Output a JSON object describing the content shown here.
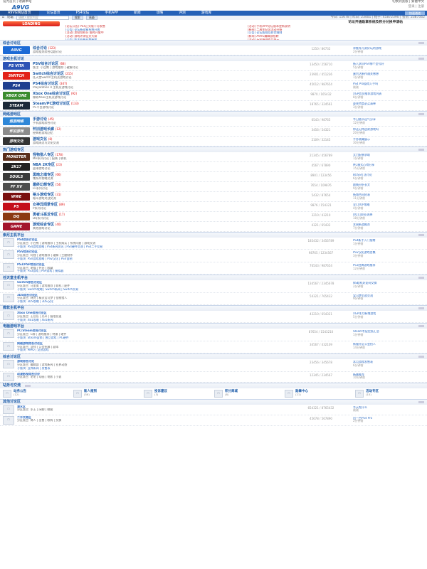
{
  "topbar": {
    "left": "设为首页 | 收藏本站",
    "right": "切换到宽版 | 繁體中文"
  },
  "logo_text": "A9VG",
  "user_text": "登录 | 注册",
  "nav": {
    "items": [
      "A9VG网站首页",
      "论坛首页",
      "PS4论坛",
      "手机APP",
      "新闻",
      "攻略",
      "评测",
      "游戏库"
    ],
    "home_btn": "快速通道"
  },
  "subbar": {
    "breadcrumb": "论坛",
    "search_placeholder": "请输入搜索内容",
    "search_btn": "搜索",
    "adv_btn": "高级",
    "stats": "今日: 15678 | 昨日: 23401 | 帖子: 45872390 | 会员: 2387562"
  },
  "notice": {
    "loading": "LOADING",
    "title": "论坛开通勋章系统及积分兑换申请帖",
    "items": [
      "[论坛公告] PS4正式版十月发售",
      "[活动] 手机APP论坛版本更新说明",
      "[公告] 论坛新勋章系统开放",
      "[新闻] 二周年纪念活动开始",
      "[活动] 发帖领积分 限时开放中",
      "[公告] 论坛版规及处罚细则",
      "[活动] 游戏评测征文大赛",
      "[新闻] A9VG编辑部招聘",
      "[公告] 版主招募长期有效",
      "[活动] 玩家原创作品展示",
      "[新闻] 东京电玩展专题上线",
      "[公告] 举报违规帖子须知"
    ]
  },
  "sections": [
    {
      "title": "综合讨论区",
      "forums": [
        {
          "badge": "A9VG",
          "color": "#1d6bd6",
          "name": "综合讨论",
          "new": "(123)",
          "desc": "游戏相关综合话题讨论",
          "stat": "1250 / 86732",
          "last": "求推荐几款好玩的游戏",
          "date": "2分钟前"
        }
      ]
    },
    {
      "title": "游戏主机讨论",
      "forums": [
        {
          "badge": "PS VITA",
          "color": "#2d53b5",
          "name": "PSV综合讨论区",
          "new": "(68)",
          "desc": "版主: 小白熊 | 游戏推荐 | 破解讨论",
          "stat": "13450 / 256710",
          "last": "新人求问PSV哪个型号好",
          "date": "5分钟前"
        },
        {
          "badge": "SWITCH",
          "color": "#e2231a",
          "name": "Switch综合讨论区",
          "new": "(215)",
          "desc": "任天堂Switch主机及游戏讨论",
          "stat": "23901 / 451236",
          "last": "塞尔达新作通关感想",
          "date": "1分钟前"
        },
        {
          "badge": "PS4",
          "color": "#1f3f8f",
          "name": "PS4综合讨论区",
          "new": "(347)",
          "desc": "PlayStation 4 主机及游戏讨论",
          "stat": "45012 / 987654",
          "last": "PS4 Pro值得入手吗",
          "date": "刚刚"
        },
        {
          "badge": "XBOX ONE",
          "color": "#3b8c2e",
          "name": "Xbox One综合讨论区",
          "new": "(92)",
          "desc": "微软Xbox主机及游戏讨论",
          "stat": "9870 / 165432",
          "last": "XGP会员推荐游戏列表",
          "date": "8分钟前"
        },
        {
          "badge": "STEAM",
          "color": "#1b2838",
          "name": "Steam/PC游戏讨论区",
          "new": "(133)",
          "desc": "PC平台游戏讨论",
          "stat": "18765 / 324561",
          "last": "夏季特卖必买清单",
          "date": "3分钟前"
        }
      ]
    },
    {
      "title": "网络游戏区",
      "forums": [
        {
          "badge": "悠游网络",
          "color": "#2f87d8",
          "name": "手游讨论",
          "new": "(45)",
          "desc": "手机游戏综合讨论",
          "stat": "6543 / 98765",
          "last": "今日抽卡运气分享",
          "date": "12分钟前"
        },
        {
          "badge": "怀旧游戏",
          "color": "#8c8c8c",
          "name": "怀旧游戏长廊",
          "new": "(12)",
          "desc": "经典老游戏回忆",
          "stat": "3456 / 54321",
          "last": "你还记得这款游戏吗",
          "date": "20分钟前"
        },
        {
          "badge": "游戏文化",
          "color": "#333333",
          "name": "游戏文化",
          "new": "(8)",
          "desc": "游戏周边与文化交流",
          "stat": "2109 / 32145",
          "last": "手办收藏展示",
          "date": "30分钟前"
        }
      ]
    },
    {
      "title": "热门游戏专区",
      "forums": [
        {
          "badge": "MONSTER",
          "color": "#5a2e1a",
          "name": "怪物猎人专区",
          "new": "(178)",
          "desc": "MH系列讨论 | 配装 | 联机",
          "stat": "21345 / 456789",
          "last": "太刀配装求助",
          "date": "1分钟前"
        },
        {
          "badge": "2K17",
          "color": "#222222",
          "name": "NBA 2K专区",
          "new": "(23)",
          "desc": "篮球游戏讨论",
          "stat": "4567 / 67890",
          "last": "MC模式心得分享",
          "date": "15分钟前"
        },
        {
          "badge": "SOULS",
          "color": "#3a3a3a",
          "name": "黑暗之魂专区",
          "new": "(66)",
          "desc": "魂系列攻略交流",
          "stat": "8901 / 123456",
          "last": "BOSS打法讨论",
          "date": "6分钟前"
        },
        {
          "badge": "FF XV",
          "color": "#4d4d4d",
          "name": "最终幻想专区",
          "new": "(54)",
          "desc": "FF系列讨论",
          "stat": "7654 / 109876",
          "last": "剧情分析长文",
          "date": "9分钟前"
        },
        {
          "badge": "WWE",
          "color": "#7a1010",
          "name": "格斗游戏专区",
          "new": "(31)",
          "desc": "格斗游戏对战交流",
          "stat": "5432 / 87654",
          "last": "新角色出招表",
          "date": "11分钟前"
        },
        {
          "badge": "P5",
          "color": "#c40f1a",
          "name": "女神异闻录专区",
          "new": "(89)",
          "desc": "P系列讨论",
          "stat": "9876 / 154321",
          "last": "全COOP攻略",
          "date": "4分钟前"
        },
        {
          "badge": "DQ",
          "color": "#8b3a12",
          "name": "勇者斗恶龙专区",
          "new": "(17)",
          "desc": "DQ系列讨论",
          "stat": "3210 / 43210",
          "last": "DQ11职业选择",
          "date": "18分钟前"
        },
        {
          "badge": "GAME",
          "color": "#a3142c",
          "name": "游戏综合专区",
          "new": "(40)",
          "desc": "其他游戏讨论",
          "stat": "4321 / 65432",
          "last": "本周新游推荐",
          "date": "7分钟前"
        }
      ]
    }
  ],
  "lower_sections": [
    {
      "title": "索尼主机平台",
      "rows": [
        {
          "name": "PS4综合讨论区",
          "lines": [
            "分区版主: 小白熊 | 游戏推荐 | 主机购买 | 系统问题 | 游戏交流",
            "子版块: PS4游戏攻略 | PS4新闻资讯 | PS4硬件交流 | PS4二手交易"
          ],
          "stat": "185432 / 3456789",
          "last": "PS4新手入门指南",
          "date": "1分钟前"
        },
        {
          "name": "PSV综合讨论区",
          "lines": [
            "分区版主: 阿狸 | 游戏推荐 | 破解 | 主题制作",
            "子版块: PSV游戏攻略 | PSV汉化 | PSV自制"
          ],
          "stat": "98765 / 1234567",
          "last": "PSV汉化游戏合集",
          "date": "3分钟前"
        },
        {
          "name": "PS3/PSP综合讨论区",
          "lines": [
            "分区版主: 老猫 | 怀旧 | 收藏",
            "子版块: PS3游戏 | PSP游戏 | 模拟器"
          ],
          "stat": "76543 / 987654",
          "last": "PS3经典游戏推荐",
          "date": "12分钟前"
        }
      ]
    },
    {
      "title": "任天堂主机平台",
      "rows": [
        {
          "name": "Switch综合讨论区",
          "lines": [
            "分区版主: 马里奥 | 游戏推荐 | 联机 | 配件",
            "子版块: Switch攻略 | Switch新闻 | Switch交易"
          ],
          "stat": "134567 / 2345678",
          "last": "NS联机好友码交换",
          "date": "2分钟前"
        },
        {
          "name": "3DS综合讨论区",
          "lines": [
            "分区版主: 林克 | 精灵宝可梦 | 怪物猎人",
            "子版块: 3DS攻略 | 3DS汉化"
          ],
          "stat": "54321 / 765432",
          "last": "宝可梦对战交流",
          "date": "9分钟前"
        }
      ]
    },
    {
      "title": "微软主机平台",
      "rows": [
        {
          "name": "Xbox One综合讨论区",
          "lines": [
            "分区版主: 士官长 | 光环 | 极限竞速",
            "子版块: XB1攻略 | XB1新闻"
          ],
          "stat": "43210 / 654321",
          "last": "XGP本月新增游戏",
          "date": "5分钟前"
        }
      ]
    },
    {
      "title": "电脑游戏平台",
      "rows": [
        {
          "name": "PC/Steam综合讨论区",
          "lines": [
            "分区版主: G胖 | 游戏推荐 | 特惠 | 硬件",
            "子版块: Steam促销 | 独立游戏 | PC硬件"
          ],
          "stat": "87654 / 1543210",
          "last": "Steam冬促史低汇总",
          "date": "1分钟前"
        },
        {
          "name": "网络游戏综合讨论区",
          "lines": [
            "分区版主: 法师 | 公会招募 | 副本",
            "子版块: MMO | 竞技游戏"
          ],
          "stat": "34567 / 432109",
          "last": "新服开区公会招人",
          "date": "14分钟前"
        }
      ]
    },
    {
      "title": "综合讨论区",
      "rows": [
        {
          "name": "游戏综合讨论",
          "lines": [
            "分区版主: 编辑部 | 游戏新闻 | 业界动态",
            "子版块: 业界新闻 | 发售表"
          ],
          "stat": "23456 / 345678",
          "last": "本月游戏发售表",
          "date": "6分钟前"
        },
        {
          "name": "动漫影视综合讨论",
          "lines": [
            "分区版主: 宅宅 | 动画 | 电影 | 小说"
          ],
          "stat": "12345 / 234567",
          "last": "新番推荐",
          "date": "10分钟前"
        }
      ]
    }
  ],
  "bottom_grid": {
    "title": "站务与交流",
    "cells": [
      {
        "n": "站务公告",
        "s": "(12)"
      },
      {
        "n": "新人报到",
        "s": "(56)"
      },
      {
        "n": "投诉建议",
        "s": "(3)"
      },
      {
        "n": "积分商城",
        "s": "(8)"
      },
      {
        "n": "勋章中心",
        "s": "(21)"
      },
      {
        "n": "活动专区",
        "s": "(15)"
      }
    ]
  },
  "final_section": {
    "title": "其他讨论区",
    "rows": [
      {
        "name": "灌水区",
        "lines": [
          "分区版主: 水王 | 闲聊 | 晒图"
        ],
        "stat": "654321 / 8765432",
        "last": "今天吃什么",
        "date": "刚刚"
      },
      {
        "name": "二手交易区",
        "lines": [
          "分区版主: 商人 | 出售 | 收购 | 交换"
        ],
        "stat": "45678 / 567890",
        "last": "出一台PS4 Pro",
        "date": "2分钟前"
      }
    ]
  }
}
